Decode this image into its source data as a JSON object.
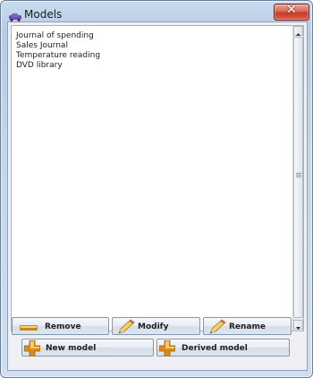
{
  "window": {
    "title": "Models"
  },
  "models": {
    "items": [
      "Journal of spending",
      "Sales Journal",
      "Temperature reading",
      "DVD library"
    ]
  },
  "buttons": {
    "remove": "Remove",
    "modify": "Modify",
    "rename": "Rename",
    "new_model": "New model",
    "derived_model": "Derived model"
  },
  "icons": {
    "app": "car-icon",
    "close": "close-icon",
    "remove": "minus-bar-icon",
    "modify": "pencil-icon",
    "rename": "pencil-icon",
    "new_model": "plus-icon",
    "derived_model": "plus-icon"
  }
}
